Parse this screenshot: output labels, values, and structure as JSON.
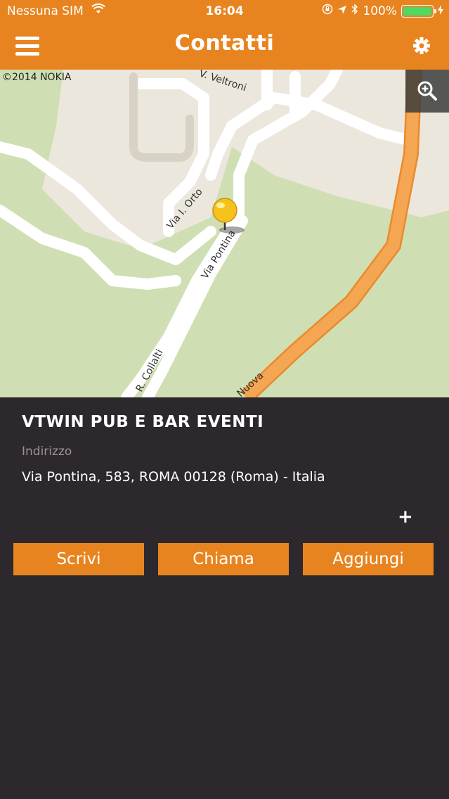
{
  "status_bar": {
    "carrier": "Nessuna SIM",
    "time": "16:04",
    "battery": "100%"
  },
  "nav": {
    "title": "Contatti",
    "menu_icon": "hamburger-menu-icon",
    "settings_icon": "gear-icon"
  },
  "map": {
    "copyright": "©2014 NOKIA",
    "zoom_icon": "zoom-in-icon",
    "street_labels": [
      "V. Veltroni",
      "Via I. Orto",
      "Via Pontina",
      "R. Collalti",
      "Nuova"
    ]
  },
  "details": {
    "name": "VTWIN PUB E BAR EVENTI",
    "address_label": "Indirizzo",
    "address": "Via Pontina, 583, ROMA 00128 (Roma) - Italia",
    "plus_label": "+"
  },
  "actions": {
    "write": "Scrivi",
    "call": "Chiama",
    "add": "Aggiungi"
  },
  "colors": {
    "accent": "#e8841f",
    "background": "#2d282d",
    "map_green": "#cfdfb3",
    "highway": "#f4a652"
  }
}
